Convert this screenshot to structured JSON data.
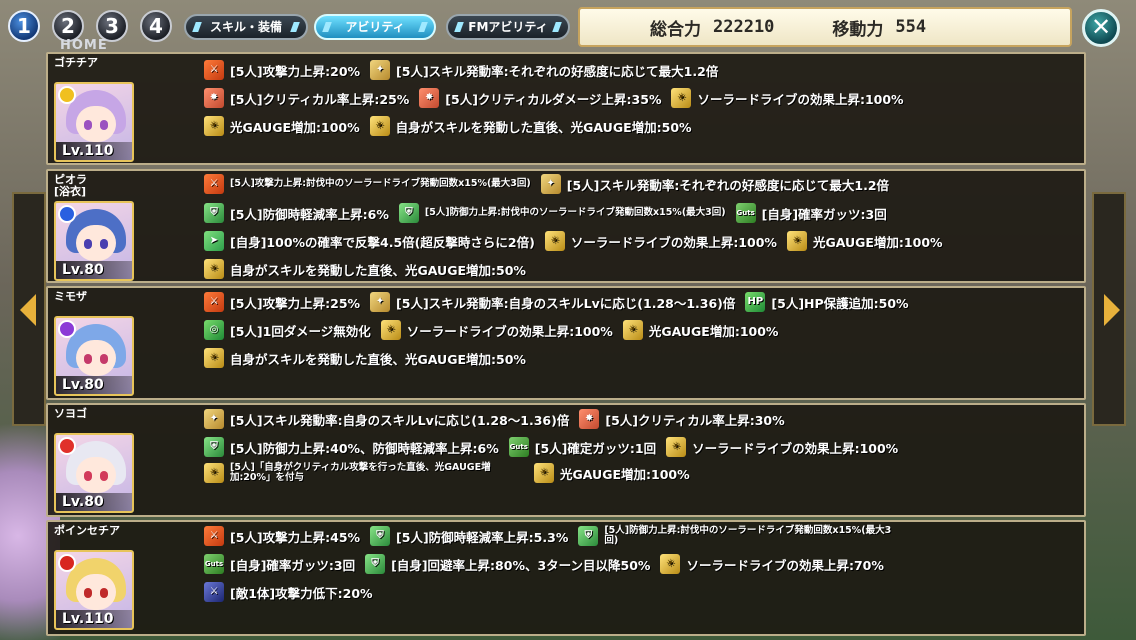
{
  "header": {
    "number_buttons": [
      "1",
      "2",
      "3",
      "4"
    ],
    "home_label": "HOME",
    "tabs": [
      "スキル・装備",
      "アビリティ",
      "FMアビリティ"
    ],
    "total_power_label": "総合力",
    "total_power_value": "222210",
    "move_power_label": "移動力",
    "move_power_value": "554",
    "close_icon": "close-icon"
  },
  "characters": [
    {
      "name": "ゴチチア",
      "level": "Lv.110",
      "lines": [
        [
          "[5人]攻撃力上昇:20%",
          "[5人]スキル発動率:それぞれの好感度に応じて最大1.2倍"
        ],
        [
          "[5人]クリティカル率上昇:25%",
          "[5人]クリティカルダメージ上昇:35%",
          "ソーラードライブの効果上昇:100%"
        ],
        [
          "光GAUGE増加:100%",
          "自身がスキルを発動した直後、光GAUGE増加:50%"
        ]
      ]
    },
    {
      "name": "ピオラ",
      "subname": "[浴衣]",
      "level": "Lv.80",
      "lines": [
        [
          "[5人]攻撃力上昇:討伐中のソーラードライブ発動回数x15%(最大3回)",
          "[5人]スキル発動率:それぞれの好感度に応じて最大1.2倍"
        ],
        [
          "[5人]防御時軽減率上昇:6%",
          "[5人]防御力上昇:討伐中のソーラードライブ発動回数x15%(最大3回)",
          "[自身]確率ガッツ:3回"
        ],
        [
          "[自身]100%の確率で反撃4.5倍(超反撃時さらに2倍)",
          "ソーラードライブの効果上昇:100%",
          "光GAUGE増加:100%"
        ],
        [
          "自身がスキルを発動した直後、光GAUGE増加:50%"
        ]
      ]
    },
    {
      "name": "ミモザ",
      "level": "Lv.80",
      "lines": [
        [
          "[5人]攻撃力上昇:25%",
          "[5人]スキル発動率:自身のスキルLvに応じ(1.28〜1.36)倍",
          "[5人]HP保護追加:50%"
        ],
        [
          "[5人]1回ダメージ無効化",
          "ソーラードライブの効果上昇:100%",
          "光GAUGE増加:100%"
        ],
        [
          "自身がスキルを発動した直後、光GAUGE増加:50%"
        ]
      ]
    },
    {
      "name": "ソヨゴ",
      "level": "Lv.80",
      "lines": [
        [
          "[5人]スキル発動率:自身のスキルLvに応じ(1.28〜1.36)倍",
          "[5人]クリティカル率上昇:30%"
        ],
        [
          "[5人]防御力上昇:40%、防御時軽減率上昇:6%",
          "[5人]確定ガッツ:1回",
          "ソーラードライブの効果上昇:100%"
        ],
        [
          "[5人]「自身がクリティカル攻撃を行った直後、光GAUGE増加:20%」を付与",
          "光GAUGE増加:100%"
        ]
      ]
    },
    {
      "name": "ポインセチア",
      "level": "Lv.110",
      "lines": [
        [
          "[5人]攻撃力上昇:45%",
          "[5人]防御時軽減率上昇:5.3%",
          "[5人]防御力上昇:討伐中のソーラードライブ発動回数x15%(最大3回)"
        ],
        [
          "[自身]確率ガッツ:3回",
          "[自身]回避率上昇:80%、3ターン目以降50%",
          "ソーラードライブの効果上昇:70%"
        ],
        [
          "[敵1体]攻撃力低下:20%"
        ]
      ]
    }
  ]
}
